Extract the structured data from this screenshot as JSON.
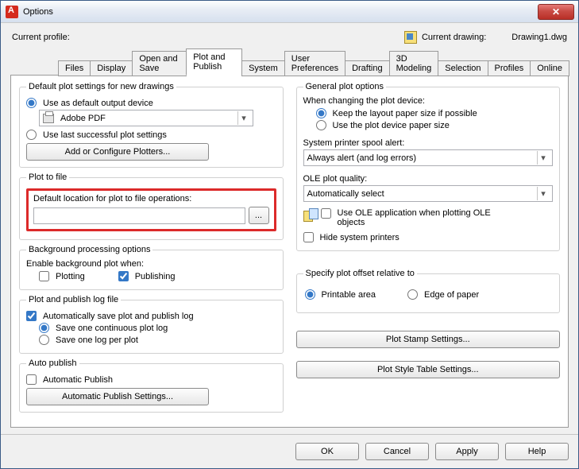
{
  "window": {
    "title": "Options"
  },
  "profile": {
    "label": "Current profile:",
    "current_drawing_label": "Current drawing:",
    "current_drawing_value": "Drawing1.dwg"
  },
  "tabs": [
    "Files",
    "Display",
    "Open and Save",
    "Plot and Publish",
    "System",
    "User Preferences",
    "Drafting",
    "3D Modeling",
    "Selection",
    "Profiles",
    "Online"
  ],
  "active_tab": "Plot and Publish",
  "left": {
    "default_plot": {
      "legend": "Default plot settings for new drawings",
      "use_default_label": "Use as default output device",
      "device_value": "Adobe PDF",
      "use_last_label": "Use last successful plot settings",
      "configure_btn": "Add or Configure Plotters..."
    },
    "plot_to_file": {
      "legend": "Plot to file",
      "loc_label": "Default location for plot to file operations:",
      "loc_value": "",
      "browse_btn": "..."
    },
    "bg": {
      "legend": "Background processing options",
      "enable_label": "Enable background plot when:",
      "plotting": "Plotting",
      "publishing": "Publishing"
    },
    "log": {
      "legend": "Plot and publish log file",
      "auto_save": "Automatically save plot and publish log",
      "one_continuous": "Save one continuous plot log",
      "one_per_plot": "Save one log per plot"
    },
    "autopub": {
      "legend": "Auto publish",
      "auto": "Automatic Publish",
      "settings_btn": "Automatic Publish Settings..."
    }
  },
  "right": {
    "general": {
      "legend": "General plot options",
      "change_label": "When changing the plot device:",
      "keep_layout": "Keep the layout paper size if possible",
      "use_device_size": "Use the plot device paper size",
      "spool_label": "System printer spool alert:",
      "spool_value": "Always alert (and log errors)",
      "ole_quality_label": "OLE plot quality:",
      "ole_quality_value": "Automatically select",
      "use_ole_app": "Use OLE application when plotting OLE objects",
      "hide_printers": "Hide system printers"
    },
    "offset": {
      "legend": "Specify plot offset relative to",
      "printable": "Printable area",
      "edge": "Edge of paper"
    },
    "stamp_btn": "Plot Stamp Settings...",
    "style_btn": "Plot Style Table Settings..."
  },
  "footer": {
    "ok": "OK",
    "cancel": "Cancel",
    "apply": "Apply",
    "help": "Help"
  }
}
